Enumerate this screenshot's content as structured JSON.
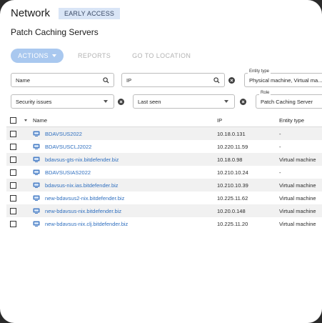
{
  "header": {
    "title": "Network",
    "badge": "EARLY ACCESS"
  },
  "page": {
    "subtitle": "Patch Caching Servers"
  },
  "toolbar": {
    "actions": "ACTIONS",
    "reports": "REPORTS",
    "go_to_location": "GO TO LOCATION"
  },
  "filters": {
    "name": {
      "value": "Name",
      "icon": "search-icon"
    },
    "ip": {
      "value": "IP",
      "icon": "search-icon"
    },
    "entity_type": {
      "label": "Entity type",
      "value": "Physical machine, Virtual ma..."
    },
    "security": {
      "value": "Security issues"
    },
    "last_seen": {
      "value": "Last seen"
    },
    "role": {
      "label": "Role",
      "value": "Patch Caching Server"
    }
  },
  "table": {
    "columns": [
      "Name",
      "IP",
      "Entity type"
    ],
    "rows": [
      {
        "name": "BDAVSUS2022",
        "ip": "10.18.0.131",
        "entity": "-"
      },
      {
        "name": "BDAVSUSCLJ2022",
        "ip": "10.220.11.59",
        "entity": "-"
      },
      {
        "name": "bdavsus-gts-nix.bitdefender.biz",
        "ip": "10.18.0.98",
        "entity": "Virtual machine"
      },
      {
        "name": "BDAVSUSIAS2022",
        "ip": "10.210.10.24",
        "entity": "-"
      },
      {
        "name": "bdavsus-nix.ias.bitdefender.biz",
        "ip": "10.210.10.39",
        "entity": "Virtual machine"
      },
      {
        "name": "new-bdavsus2-nix.bitdefender.biz",
        "ip": "10.225.11.62",
        "entity": "Virtual machine"
      },
      {
        "name": "new-bdavsus-nix.bitdefender.biz",
        "ip": "10.20.0.148",
        "entity": "Virtual machine"
      },
      {
        "name": "new-bdavsus-nix.clj.bitdefender.biz",
        "ip": "10.225.11.20",
        "entity": "Virtual machine"
      }
    ]
  },
  "colors": {
    "link": "#2f6fbf",
    "actions_button": "#a9c8ef",
    "badge_bg": "#d9e5f6",
    "row_shade": "#f1f1f1"
  }
}
